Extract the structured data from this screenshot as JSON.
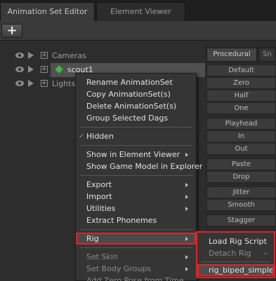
{
  "tabs": {
    "active": "Animation Set Editor",
    "inactive": "Element Viewer"
  },
  "toolbar": {
    "add_label": "+"
  },
  "tree": {
    "cameras": "Cameras",
    "scout": "scout1",
    "lights": "Lights"
  },
  "right_panel": {
    "tab_procedural": "Procedural",
    "tab_other": "Sn",
    "buttons": [
      "Default",
      "Zero",
      "Half",
      "One",
      "Playhead",
      "In",
      "Out",
      "Paste",
      "Drop",
      "Jitter",
      "Smooth",
      "Stagger"
    ]
  },
  "context_menu": {
    "rename": "Rename AnimationSet",
    "copy": "Copy AnimationSet(s)",
    "delete": "Delete AnimationSet(s)",
    "group": "Group Selected Dags",
    "hidden": "Hidden",
    "hidden_check": "✓",
    "show_in_viewer": "Show in Element Viewer",
    "show_game_model": "Show Game Model in Explorer",
    "export": "Export",
    "import": "Import",
    "utilities": "Utilities",
    "extract_phonemes": "Extract Phonemes",
    "rig": "Rig",
    "set_skin": "Set Skin",
    "set_body_groups": "Set Body Groups",
    "add_zero_pose": "Add Zero Pose from Time"
  },
  "rig_submenu": {
    "load_rig_script": "Load Rig Script",
    "detach_rig": "Detach Rig",
    "rig_biped_simple": "rig_biped_simple"
  }
}
